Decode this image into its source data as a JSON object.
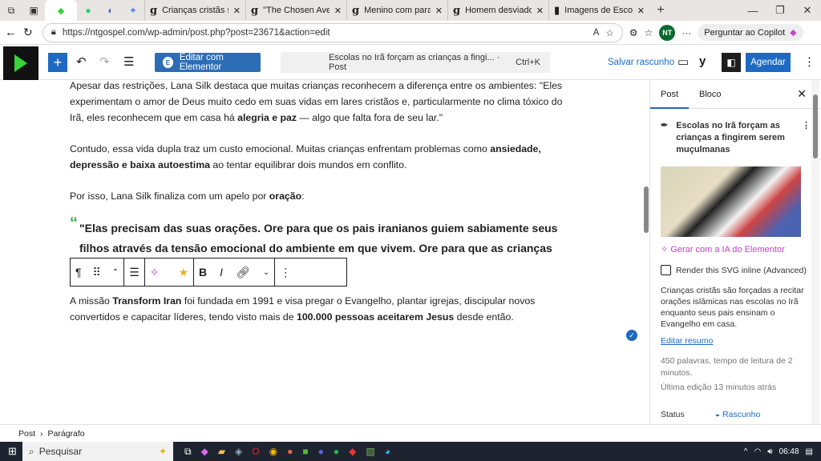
{
  "browser": {
    "tabs": [
      {
        "title": "Crianças cristãs são fo",
        "favicon": "g"
      },
      {
        "title": "\"The Chosen Aventur",
        "favicon": "g"
      },
      {
        "title": "Menino com paralisia",
        "favicon": "g"
      },
      {
        "title": "Homem desviado há",
        "favicon": "g"
      },
      {
        "title": "Imagens de Escolas N",
        "favicon": "▮"
      }
    ],
    "url": "https://ntgospel.com/wp-admin/post.php?post=23671&action=edit",
    "profile": "NT",
    "copilot": "Perguntar ao Copilot"
  },
  "editor": {
    "elementor_button": "Editar com Elementor",
    "command_title": "Escolas no Irã forçam as crianças a fingi... · Post",
    "shortcut": "Ctrl+K",
    "save_draft": "Salvar rascunho",
    "schedule": "Agendar"
  },
  "content": {
    "p1": [
      "Apesar das restrições, Lana Silk destaca que muitas crianças reconhecem a diferença entre os ambientes: \"Eles experimentam o amor de Deus muito cedo em suas vidas em lares cristãos e, particularmente no clima tóxico do Irã, eles reconhecem que em casa há ",
      "alegria e paz",
      " — algo que falta fora de seu lar.\""
    ],
    "p2": [
      "Contudo, essa vida dupla traz um custo emocional. Muitas crianças enfrentam problemas como ",
      "ansiedade, depressão e baixa autoestima",
      " ao tentar equilibrar dois mundos em conflito."
    ],
    "p3": [
      "Por isso, Lana Silk finaliza com um apelo por ",
      "oração",
      ":"
    ],
    "quote": "\"Elas precisam das suas orações. Ore para que os pais iranianos guiem sabiamente seus filhos através da tensão emocional do ambiente em que vivem. Ore para que as crianças se",
    "p4": [
      "A missão ",
      "Transform Iran",
      " foi fundada em 1991 e visa pregar o Evangelho, plantar igrejas, discipular novos convertidos e capacitar líderes, tendo visto mais de ",
      "100.000 pessoas aceitarem Jesus",
      " desde então."
    ]
  },
  "sidebar": {
    "tabs": [
      "Post",
      "Bloco"
    ],
    "post_title": "Escolas no Irã forçam as crianças a fingirem serem muçulmanas",
    "generate_ai": "Gerar com a IA do Elementor",
    "svg_inline": "Render this SVG inline (Advanced)",
    "excerpt": "Crianças cristãs são forçadas a recitar orações islâmicas nas escolas no Irã enquanto seus pais ensinam o Evangelho em casa.",
    "edit_excerpt": "Editar resumo",
    "word_count": "450 palavras, tempo de leitura de 2 minutos.",
    "last_edit": "Última edição 13 minutos atrás",
    "status_label": "Status",
    "status_value": "Rascunho"
  },
  "footer": {
    "breadcrumb": [
      "Post",
      "Parágrafo"
    ]
  },
  "taskbar": {
    "search": "Pesquisar",
    "time": "06:48"
  }
}
